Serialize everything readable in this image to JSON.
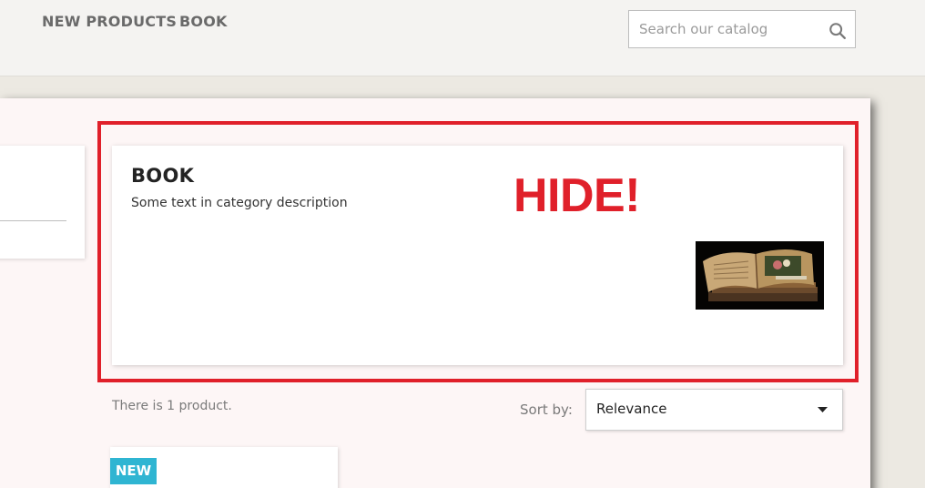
{
  "header": {
    "nav": [
      "NEW PRODUCTS",
      "BOOK"
    ],
    "search": {
      "placeholder": "Search our catalog",
      "icon": "search-icon"
    }
  },
  "category": {
    "title": "BOOK",
    "description": "Some text in category description",
    "annotation": "HIDE!",
    "image": "book-image"
  },
  "listing": {
    "product_count": "There is 1 product.",
    "sort_label": "Sort by:",
    "sort_value": "Relevance"
  },
  "product": {
    "badge": "NEW"
  },
  "colors": {
    "annotation_red": "#e0202a",
    "badge_blue": "#2fb5d2",
    "panel_bg": "#fdf6f6"
  }
}
